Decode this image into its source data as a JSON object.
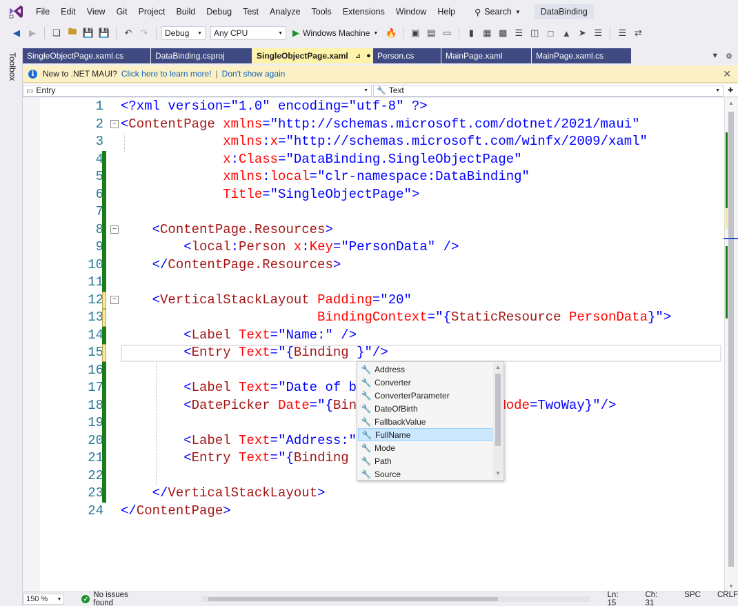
{
  "menubar": {
    "items": [
      "File",
      "Edit",
      "View",
      "Git",
      "Project",
      "Build",
      "Debug",
      "Test",
      "Analyze",
      "Tools",
      "Extensions",
      "Window",
      "Help"
    ],
    "search_label": "Search",
    "solution_name": "DataBinding"
  },
  "toolbar": {
    "configuration": "Debug",
    "platform": "Any CPU",
    "run_target": "Windows Machine"
  },
  "toolbox_label": "Toolbox",
  "tabs": [
    {
      "label": "SingleObjectPage.xaml.cs",
      "active": false
    },
    {
      "label": "DataBinding.csproj",
      "active": false
    },
    {
      "label": "SingleObjectPage.xaml",
      "active": true
    },
    {
      "label": "Person.cs",
      "active": false
    },
    {
      "label": "MainPage.xaml",
      "active": false
    },
    {
      "label": "MainPage.xaml.cs",
      "active": false
    }
  ],
  "infobar": {
    "message": "New to .NET MAUI?",
    "learn_link": "Click here to learn more!",
    "separator": "|",
    "dismiss_link": "Don't show again"
  },
  "navbar": {
    "element_selector": "Entry",
    "member_selector": "Text"
  },
  "code_lines": [
    {
      "n": "1"
    },
    {
      "n": "2"
    },
    {
      "n": "3"
    },
    {
      "n": "4"
    },
    {
      "n": "5"
    },
    {
      "n": "6"
    },
    {
      "n": "7"
    },
    {
      "n": "8"
    },
    {
      "n": "9"
    },
    {
      "n": "10"
    },
    {
      "n": "11"
    },
    {
      "n": "12"
    },
    {
      "n": "13"
    },
    {
      "n": "14"
    },
    {
      "n": "15"
    },
    {
      "n": "16"
    },
    {
      "n": "17"
    },
    {
      "n": "18"
    },
    {
      "n": "19"
    },
    {
      "n": "20"
    },
    {
      "n": "21"
    },
    {
      "n": "22"
    },
    {
      "n": "23"
    },
    {
      "n": "24"
    }
  ],
  "code": {
    "l1": [
      "<?xml version=\"1.0\" encoding=\"utf-8\" ?>"
    ],
    "l2": [
      "<",
      "ContentPage",
      " ",
      "xmlns",
      "=",
      "\"http://schemas.microsoft.com/dotnet/2021/maui\""
    ],
    "l3": [
      "             ",
      "xmlns",
      ":",
      "x",
      "=",
      "\"http://schemas.microsoft.com/winfx/2009/xaml\""
    ],
    "l4": [
      "             ",
      "x",
      ":",
      "Class",
      "=",
      "\"DataBinding.SingleObjectPage\""
    ],
    "l5": [
      "             ",
      "xmlns",
      ":",
      "local",
      "=",
      "\"clr-namespace:DataBinding\""
    ],
    "l6": [
      "             ",
      "Title",
      "=",
      "\"SingleObjectPage\"",
      ">"
    ],
    "l8": [
      "    ",
      "<",
      "ContentPage.Resources",
      ">"
    ],
    "l9": [
      "        ",
      "<",
      "local",
      ":",
      "Person",
      " ",
      "x",
      ":",
      "Key",
      "=",
      "\"PersonData\"",
      " />"
    ],
    "l10": [
      "    ",
      "</",
      "ContentPage.Resources",
      ">"
    ],
    "l12": [
      "    ",
      "<",
      "VerticalStackLayout",
      " ",
      "Padding",
      "=",
      "\"20\""
    ],
    "l13": [
      "                         ",
      "BindingContext",
      "=",
      "\"{",
      "StaticResource",
      " ",
      "PersonData",
      "}\"",
      ">"
    ],
    "l14": [
      "        ",
      "<",
      "Label",
      " ",
      "Text",
      "=",
      "\"Name:\"",
      " />"
    ],
    "l15": [
      "        ",
      "<",
      "Entry",
      " ",
      "Text",
      "=",
      "\"{",
      "Binding",
      " }\"",
      "/>"
    ],
    "l17": [
      "        ",
      "<",
      "Label",
      " ",
      "Text",
      "=",
      "\"Date of b"
    ],
    "l18": [
      "        ",
      "<",
      "DatePicker",
      " ",
      "Date",
      "=",
      "\"{",
      "Bin",
      "                  ",
      "Mode",
      "=",
      "TwoWay",
      "}\"",
      "/>"
    ],
    "l20": [
      "        ",
      "<",
      "Label",
      " ",
      "Text",
      "=",
      "\"Address:\""
    ],
    "l21": [
      "        ",
      "<",
      "Entry",
      " ",
      "Text",
      "=",
      "\"{",
      "Binding"
    ],
    "l23": [
      "    ",
      "</",
      "VerticalStackLayout",
      ">"
    ],
    "l24": [
      "</",
      "ContentPage",
      ">"
    ]
  },
  "intellisense": {
    "items": [
      {
        "label": "Address",
        "icon": "property-icon"
      },
      {
        "label": "Converter",
        "icon": "wrench-icon"
      },
      {
        "label": "ConverterParameter",
        "icon": "wrench-icon"
      },
      {
        "label": "DateOfBirth",
        "icon": "property-icon"
      },
      {
        "label": "FallbackValue",
        "icon": "wrench-icon"
      },
      {
        "label": "FullName",
        "icon": "property-icon"
      },
      {
        "label": "Mode",
        "icon": "wrench-icon"
      },
      {
        "label": "Path",
        "icon": "wrench-icon"
      },
      {
        "label": "Source",
        "icon": "wrench-icon"
      }
    ],
    "selected": "FullName"
  },
  "statusbar": {
    "zoom": "150 %",
    "issues": "No issues found",
    "line": "Ln: 15",
    "col": "Ch: 31",
    "whitespace": "SPC",
    "line_ending": "CRLF"
  },
  "colors": {
    "accent": "#3f4a82",
    "active_tab": "#fef3a8",
    "change_saved": "#1a7b1a",
    "change_unsaved": "#f2e8a0",
    "xml_tag": "#a31515",
    "xml_attr": "#ff0000",
    "xml_value": "#0000ff"
  }
}
